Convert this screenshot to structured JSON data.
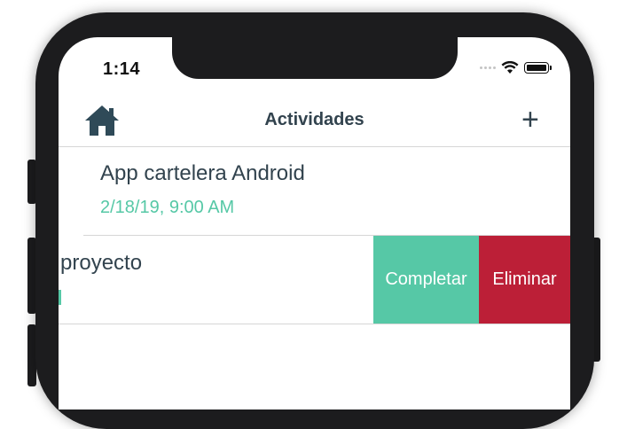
{
  "status_bar": {
    "time": "1:14"
  },
  "navbar": {
    "title": "Actividades",
    "add_label": "+",
    "home_icon": "home-icon"
  },
  "activities": [
    {
      "title": "App cartelera Android",
      "date": "2/18/19, 9:00 AM"
    },
    {
      "title": "o proyecto",
      "actions": {
        "complete_label": "Completar",
        "delete_label": "Eliminar"
      }
    }
  ],
  "colors": {
    "accent_green": "#56c8a6",
    "delete_red": "#bc1f37",
    "text_dark": "#32434e"
  }
}
